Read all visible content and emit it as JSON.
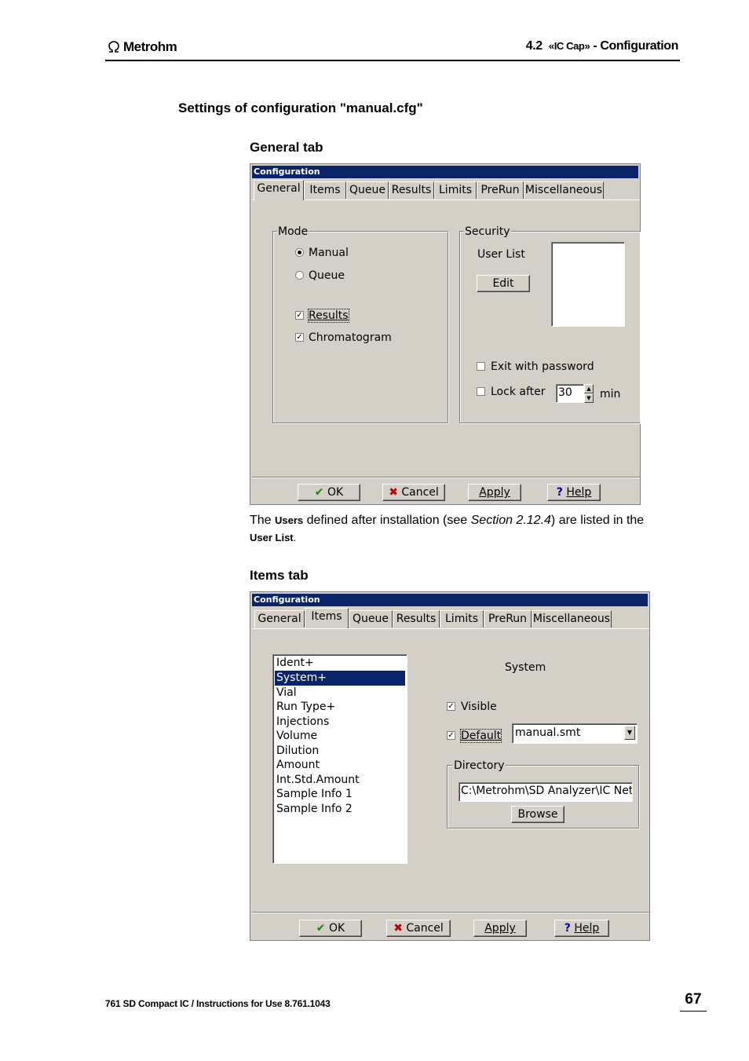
{
  "header": {
    "brand": "Metrohm",
    "section_number": "4.2",
    "section_prefix": "«IC Cap»",
    "section_suffix": " - Configuration"
  },
  "heading_settings": "Settings of configuration \"manual.cfg\"",
  "heading_general_tab": "General tab",
  "heading_items_tab": "Items tab",
  "paragraph": {
    "t1": "The ",
    "users": "Users",
    "t2": " defined after installation (see ",
    "section_ref": "Section 2.12.4",
    "t3": ") are listed in the ",
    "user_list": "User List",
    "t4": "."
  },
  "general_dialog": {
    "title": "Configuration",
    "tabs": [
      "General",
      "Items",
      "Queue",
      "Results",
      "Limits",
      "PreRun",
      "Miscellaneous"
    ],
    "mode_group": "Mode",
    "radio_manual": "Manual",
    "radio_queue": "Queue",
    "chk_results": "Results",
    "chk_chromatogram": "Chromatogram",
    "security_group": "Security",
    "user_list_label": "User List",
    "edit_button": "Edit",
    "chk_exit_password": "Exit with password",
    "chk_lock_after": "Lock after",
    "lock_minutes": "30",
    "min_label": "min",
    "ok_button": "OK",
    "cancel_button": "Cancel",
    "apply_button": "Apply",
    "help_button": "Help"
  },
  "items_dialog": {
    "title": "Configuration",
    "tabs": [
      "General",
      "Items",
      "Queue",
      "Results",
      "Limits",
      "PreRun",
      "Miscellaneous"
    ],
    "list_items": [
      "Ident+",
      "System+",
      "Vial",
      "Run Type+",
      "Injections",
      "Volume",
      "Dilution",
      "Amount",
      "Int.Std.Amount",
      "Sample Info 1",
      "Sample Info 2"
    ],
    "selected_item": "System+",
    "item_heading": "System",
    "chk_visible": "Visible",
    "chk_default": "Default",
    "default_select_value": "manual.smt",
    "directory_group": "Directory",
    "directory_value": "C:\\Metrohm\\SD Analyzer\\IC Net\\",
    "browse_button": "Browse",
    "ok_button": "OK",
    "cancel_button": "Cancel",
    "apply_button": "Apply",
    "help_button": "Help"
  },
  "footer": {
    "left": "761 SD Compact IC / Instructions for Use  8.761.1043",
    "page_number": "67"
  }
}
